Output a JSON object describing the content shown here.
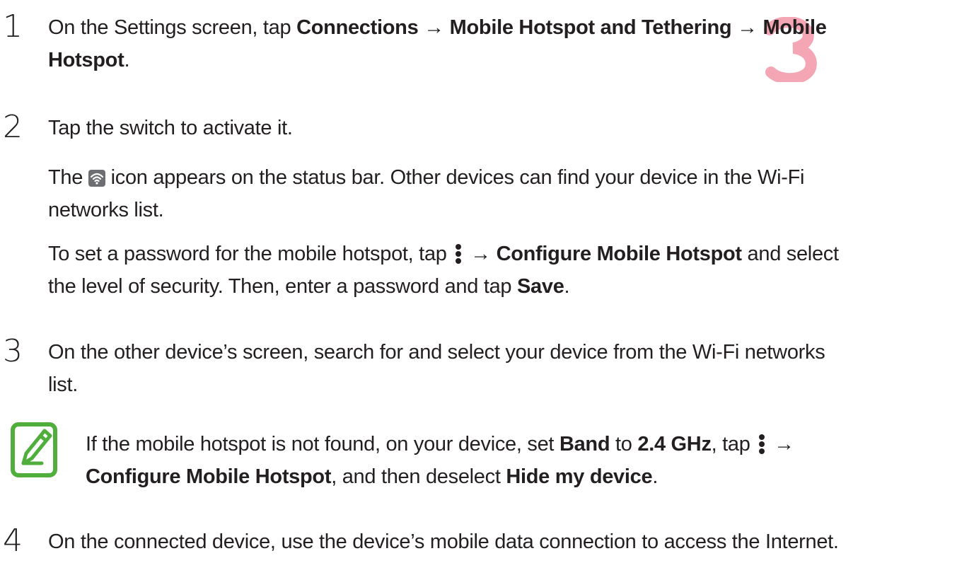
{
  "watermark": {
    "text": "3",
    "color": "#f4a6b4"
  },
  "icons": {
    "hotspot_status": "mobile-hotspot-status-icon",
    "more_options": "more-options-kebab-icon",
    "note": "note-pencil-icon"
  },
  "colors": {
    "text": "#231f20",
    "note_icon": "#4fae3c"
  },
  "steps": [
    {
      "number": "1",
      "line1": {
        "a": "On the Settings screen, tap ",
        "b1": "Connections",
        "c": " → ",
        "b2": "Mobile Hotspot and Tethering",
        "d": " → ",
        "b3": "Mobile"
      },
      "line2": {
        "b1": "Hotspot",
        "a": "."
      }
    },
    {
      "number": "2",
      "main": "Tap the switch to activate it.",
      "detail1": {
        "a": "The ",
        "b": " icon appears on the status bar. Other devices can find your device in the Wi-Fi",
        "c": "networks list."
      },
      "detail2": {
        "a": "To set a password for the mobile hotspot, tap ",
        "b": " → ",
        "bold1": "Configure Mobile Hotspot",
        "c": " and select",
        "d": "the level of security. Then, enter a password and tap ",
        "bold2": "Save",
        "e": "."
      }
    },
    {
      "number": "3",
      "line1": "On the other device’s screen, search for and select your device from the Wi-Fi networks",
      "line2": "list."
    },
    {
      "number": "4",
      "line1": "On the connected device, use the device’s mobile data connection to access the Internet."
    }
  ],
  "note": {
    "a": "If the mobile hotspot is not found, on your device, set ",
    "bold1": "Band",
    "b": " to ",
    "bold2": "2.4 GHz",
    "c": ", tap ",
    "d": " →",
    "bold3": "Configure Mobile Hotspot",
    "e": ", and then deselect ",
    "bold4": "Hide my device",
    "f": "."
  }
}
